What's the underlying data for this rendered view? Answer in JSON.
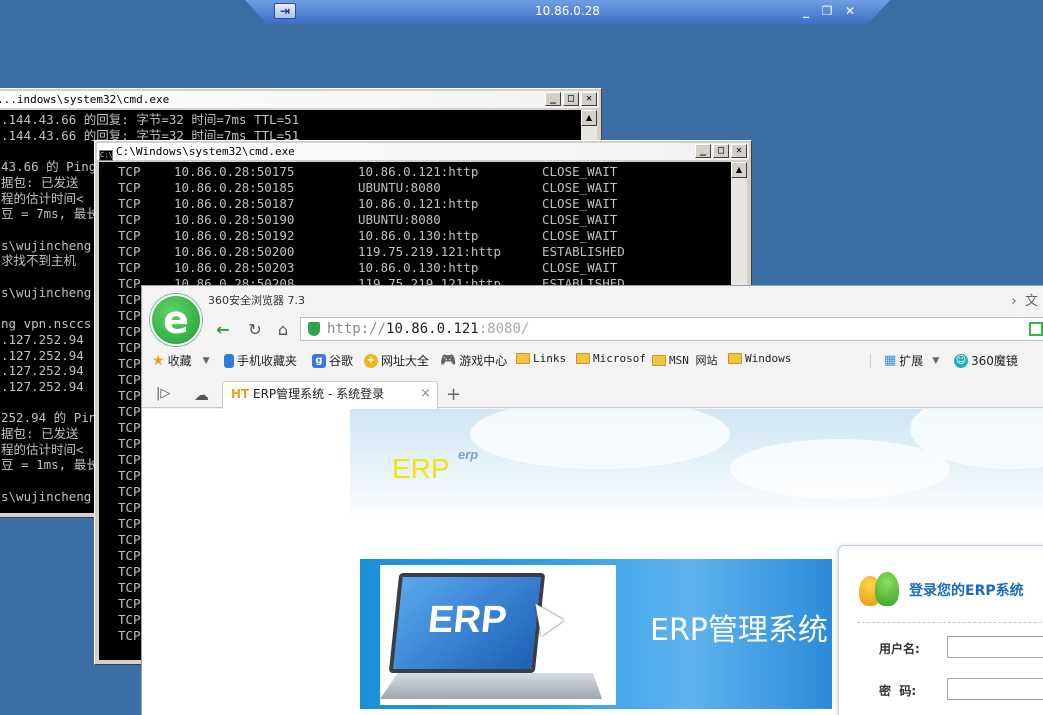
{
  "rdp": {
    "title": "10.86.0.28",
    "pin": "⇥"
  },
  "cmd1": {
    "title": "...indows\\system32\\cmd.exe",
    "lines": [
      ".144.43.66 的回复: 字节=32 时间=7ms TTL=51",
      ".144.43.66 的回复: 字节=32 时间=7ms TTL=51",
      "",
      "43.66 的 Ping",
      "据包: 已发送",
      "程的估计时间<",
      "豆 = 7ms, 最长",
      "",
      "s\\wujincheng",
      "求找不到主机",
      "",
      "s\\wujincheng",
      "",
      "ng vpn.nsccs",
      ".127.252.94",
      ".127.252.94",
      ".127.252.94",
      ".127.252.94",
      "",
      "252.94 的 Ping",
      "据包: 已发送",
      "程的估计时间<",
      "豆 = 1ms, 最长",
      "",
      "s\\wujincheng"
    ]
  },
  "cmd2": {
    "title": "C:\\Windows\\system32\\cmd.exe",
    "rows": [
      [
        "TCP",
        "10.86.0.28:50175",
        "10.86.0.121:http",
        "CLOSE_WAIT"
      ],
      [
        "TCP",
        "10.86.0.28:50185",
        "UBUNTU:8080",
        "CLOSE_WAIT"
      ],
      [
        "TCP",
        "10.86.0.28:50187",
        "10.86.0.121:http",
        "CLOSE_WAIT"
      ],
      [
        "TCP",
        "10.86.0.28:50190",
        "UBUNTU:8080",
        "CLOSE_WAIT"
      ],
      [
        "TCP",
        "10.86.0.28:50192",
        "10.86.0.130:http",
        "CLOSE_WAIT"
      ],
      [
        "TCP",
        "10.86.0.28:50200",
        "119.75.219.121:http",
        "ESTABLISHED"
      ],
      [
        "TCP",
        "10.86.0.28:50203",
        "10.86.0.130:http",
        "CLOSE_WAIT"
      ],
      [
        "TCP",
        "10.86.0.28:50208",
        "119.75.219.121:http",
        "ESTABLISHED"
      ],
      [
        "TCP",
        "",
        "",
        ""
      ],
      [
        "TCP",
        "",
        "",
        ""
      ],
      [
        "TCP",
        "",
        "",
        ""
      ],
      [
        "TCP",
        "",
        "",
        ""
      ],
      [
        "TCP",
        "",
        "",
        ""
      ],
      [
        "TCP",
        "",
        "",
        ""
      ],
      [
        "TCP",
        "",
        "",
        ""
      ],
      [
        "TCP",
        "",
        "",
        ""
      ],
      [
        "TCP",
        "",
        "",
        ""
      ],
      [
        "TCP",
        "",
        "",
        ""
      ],
      [
        "TCP",
        "",
        "",
        ""
      ],
      [
        "TCP",
        "",
        "",
        ""
      ],
      [
        "TCP",
        "",
        "",
        ""
      ],
      [
        "TCP",
        "",
        "",
        ""
      ],
      [
        "TCP",
        "",
        "",
        ""
      ],
      [
        "TCP",
        "",
        "",
        ""
      ],
      [
        "TCP",
        "",
        "",
        ""
      ],
      [
        "TCP",
        "",
        "",
        ""
      ],
      [
        "TCP",
        "",
        "",
        ""
      ],
      [
        "TCP",
        "",
        "",
        ""
      ],
      [
        "TCP",
        "",
        "",
        ""
      ],
      [
        "TCP",
        "",
        "",
        ""
      ]
    ]
  },
  "browser": {
    "title": "360安全浏览器 7.3",
    "menu_right": "文",
    "url_scheme": "http://",
    "url_host": "10.86.0.121",
    "url_port": ":8080/",
    "bookmarks": [
      {
        "label": "收藏",
        "icon": "star"
      },
      {
        "label": "手机收藏夹",
        "icon": "phone"
      },
      {
        "label": "谷歌",
        "icon": "google"
      },
      {
        "label": "网址大全",
        "icon": "plus"
      },
      {
        "label": "游戏中心",
        "icon": "game"
      },
      {
        "label": "Links",
        "icon": "folder"
      },
      {
        "label": "Microsof",
        "icon": "folder"
      },
      {
        "label": "MSN 网站",
        "icon": "folder"
      },
      {
        "label": "Windows",
        "icon": "folder"
      }
    ],
    "ext_label": "扩展",
    "magic_label": "360魔镜",
    "tab": {
      "favicon": "HT",
      "title": "ERP管理系统 - 系统登录"
    }
  },
  "erp": {
    "logo": "ERP",
    "logo_sub": "erp",
    "screen_text": "ERP",
    "banner_title": "ERP管理系统",
    "login_title": "登录您的ERP系统",
    "username_label": "用户名:",
    "password_label": "密  码:"
  },
  "colors": {
    "desktop": "#3a6ea5",
    "terminal_bg": "#000000",
    "terminal_fg": "#c0c0c0",
    "accent_green": "#1d9f36",
    "login_blue": "#1a6bbd"
  }
}
